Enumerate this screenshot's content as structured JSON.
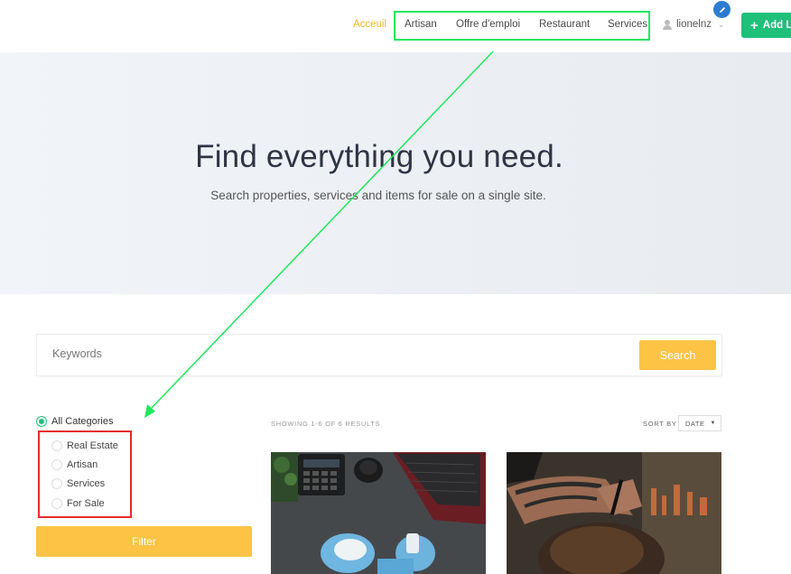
{
  "nav": {
    "home": "Acceuil",
    "items": [
      "Artisan",
      "Offre d'emploi",
      "Restaurant",
      "Services"
    ],
    "user": "lionelnz",
    "add_button": "Add L"
  },
  "hero": {
    "title": "Find everything you need.",
    "subtitle": "Search properties, services and items for sale on a single site."
  },
  "search": {
    "placeholder": "Keywords",
    "button": "Search"
  },
  "filters": {
    "all_label": "All Categories",
    "categories": [
      "Real Estate",
      "Artisan",
      "Services",
      "For Sale"
    ],
    "button": "Filter"
  },
  "results": {
    "count_text": "SHOWING 1-6 OF 6 RESULTS",
    "sort_label": "SORT BY",
    "sort_value": "DATE"
  },
  "colors": {
    "accent_yellow": "#fcc344",
    "accent_green": "#1ec07a",
    "annotation_green": "#1ee85c",
    "annotation_red": "#e52b2b",
    "edit_blue": "#2b7bd0"
  }
}
